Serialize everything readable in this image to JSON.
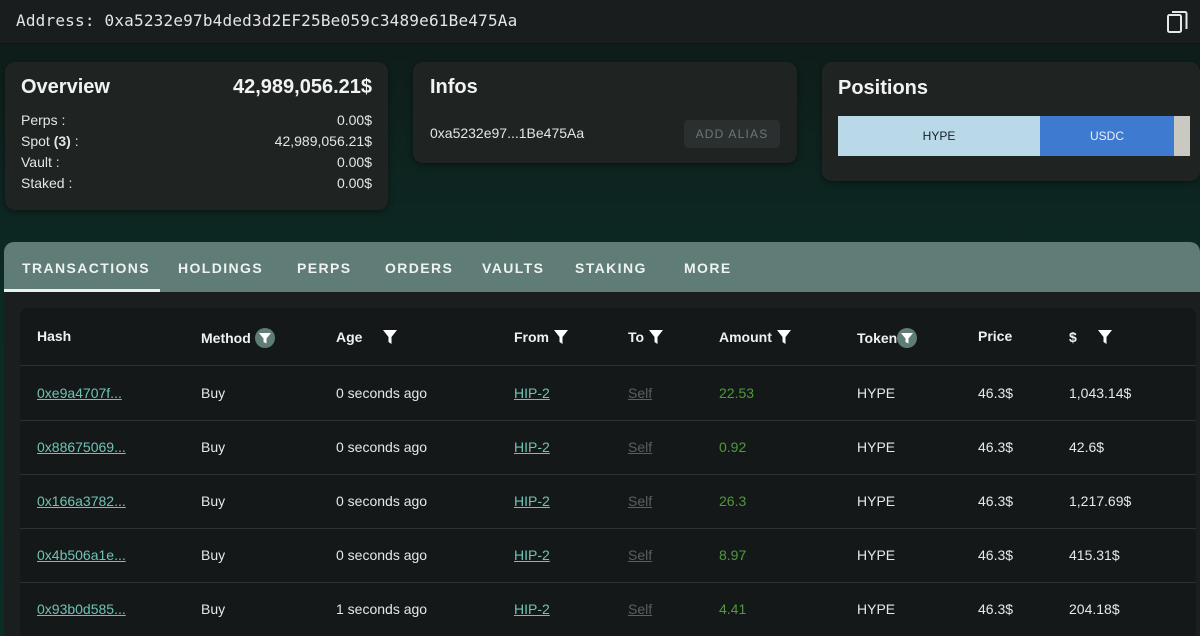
{
  "address_bar": {
    "text": "Address: 0xa5232e97b4ded3d2EF25Be059c3489e61Be475Aa"
  },
  "overview": {
    "title": "Overview",
    "total": "42,989,056.21$",
    "rows": [
      {
        "label": "Perps :",
        "value": "0.00$"
      },
      {
        "label_prefix": "Spot ",
        "label_count": "(3)",
        "label_suffix": " :",
        "value": "42,989,056.21$"
      },
      {
        "label": "Vault :",
        "value": "0.00$"
      },
      {
        "label": "Staked :",
        "value": "0.00$"
      }
    ]
  },
  "infos": {
    "title": "Infos",
    "short_address": "0xa5232e97...1Be475Aa",
    "alias_button": "ADD ALIAS"
  },
  "positions": {
    "title": "Positions",
    "segments": [
      {
        "label": "HYPE",
        "color": "#b9d9e8"
      },
      {
        "label": "USDC",
        "color": "#3d7ad0"
      },
      {
        "label": "",
        "color": "#c9c9c1"
      }
    ]
  },
  "tabs": [
    "TRANSACTIONS",
    "HOLDINGS",
    "PERPS",
    "ORDERS",
    "VAULTS",
    "STAKING",
    "MORE"
  ],
  "active_tab": "TRANSACTIONS",
  "table": {
    "headers": [
      "Hash",
      "Method",
      "Age",
      "From",
      "To",
      "Amount",
      "Token",
      "Price",
      "$"
    ],
    "rows": [
      {
        "hash": "0xe9a4707f...",
        "method": "Buy",
        "age": "0 seconds ago",
        "from": "HIP-2",
        "to": "Self",
        "amount": "22.53",
        "token": "HYPE",
        "price": "46.3$",
        "usd": "1,043.14$"
      },
      {
        "hash": "0x88675069...",
        "method": "Buy",
        "age": "0 seconds ago",
        "from": "HIP-2",
        "to": "Self",
        "amount": "0.92",
        "token": "HYPE",
        "price": "46.3$",
        "usd": "42.6$"
      },
      {
        "hash": "0x166a3782...",
        "method": "Buy",
        "age": "0 seconds ago",
        "from": "HIP-2",
        "to": "Self",
        "amount": "26.3",
        "token": "HYPE",
        "price": "46.3$",
        "usd": "1,217.69$"
      },
      {
        "hash": "0x4b506a1e...",
        "method": "Buy",
        "age": "0 seconds ago",
        "from": "HIP-2",
        "to": "Self",
        "amount": "8.97",
        "token": "HYPE",
        "price": "46.3$",
        "usd": "415.31$"
      },
      {
        "hash": "0x93b0d585...",
        "method": "Buy",
        "age": "1 seconds ago",
        "from": "HIP-2",
        "to": "Self",
        "amount": "4.41",
        "token": "HYPE",
        "price": "46.3$",
        "usd": "204.18$"
      }
    ]
  },
  "colors": {
    "accent_link": "#6fc3b4",
    "amount_green": "#4f9a3d",
    "tab_bar": "#5f7c77"
  },
  "icons": {
    "copy": "copy-icon",
    "filter": "filter-icon"
  }
}
